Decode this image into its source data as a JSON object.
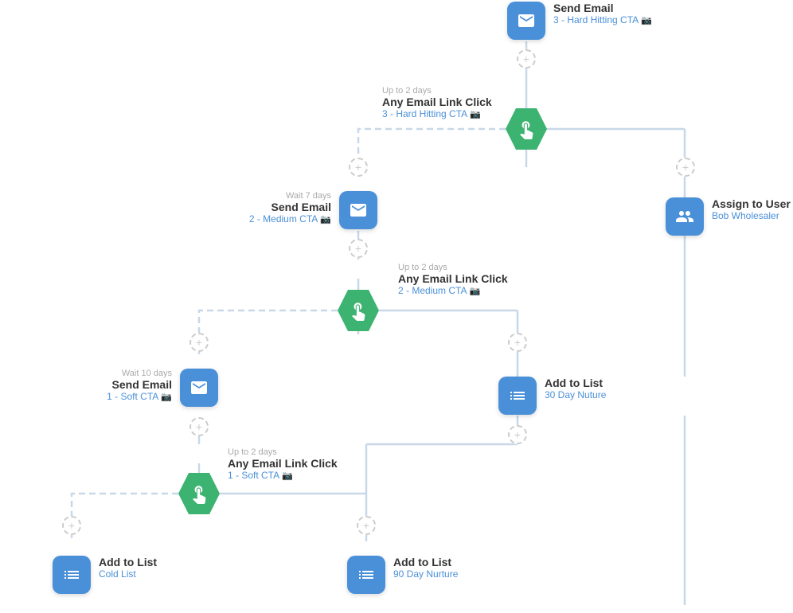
{
  "nodes": {
    "sendEmail1": {
      "title": "Send Email",
      "subtitle": "",
      "detail": "3 - Hard Hitting CTA",
      "type": "email"
    },
    "click1": {
      "subtitle": "Up to 2 days",
      "title": "Any Email Link Click",
      "detail": "3 - Hard Hitting CTA",
      "type": "click"
    },
    "assignUser": {
      "title": "Assign to User",
      "detail": "Bob Wholesaler",
      "type": "assign"
    },
    "sendEmail2": {
      "subtitle": "Wait 7 days",
      "title": "Send Email",
      "detail": "2 - Medium CTA",
      "type": "email"
    },
    "click2": {
      "subtitle": "Up to 2 days",
      "title": "Any Email Link Click",
      "detail": "2 - Medium CTA",
      "type": "click"
    },
    "addToList1": {
      "title": "Add to List",
      "detail": "30 Day Nuture",
      "type": "list"
    },
    "sendEmail3": {
      "subtitle": "Wait 10 days",
      "title": "Send Email",
      "detail": "1 - Soft CTA",
      "type": "email"
    },
    "click3": {
      "subtitle": "Up to 2 days",
      "title": "Any Email Link Click",
      "detail": "1 - Soft CTA",
      "type": "click"
    },
    "addToList2": {
      "title": "Add to List",
      "detail": "Cold List",
      "type": "list"
    },
    "addToList3": {
      "title": "Add to List",
      "detail": "90 Day Nurture",
      "type": "list"
    }
  },
  "icons": {
    "email": "✉",
    "list": "≡",
    "assign": "👤",
    "camera": "📷",
    "plus": "+"
  }
}
